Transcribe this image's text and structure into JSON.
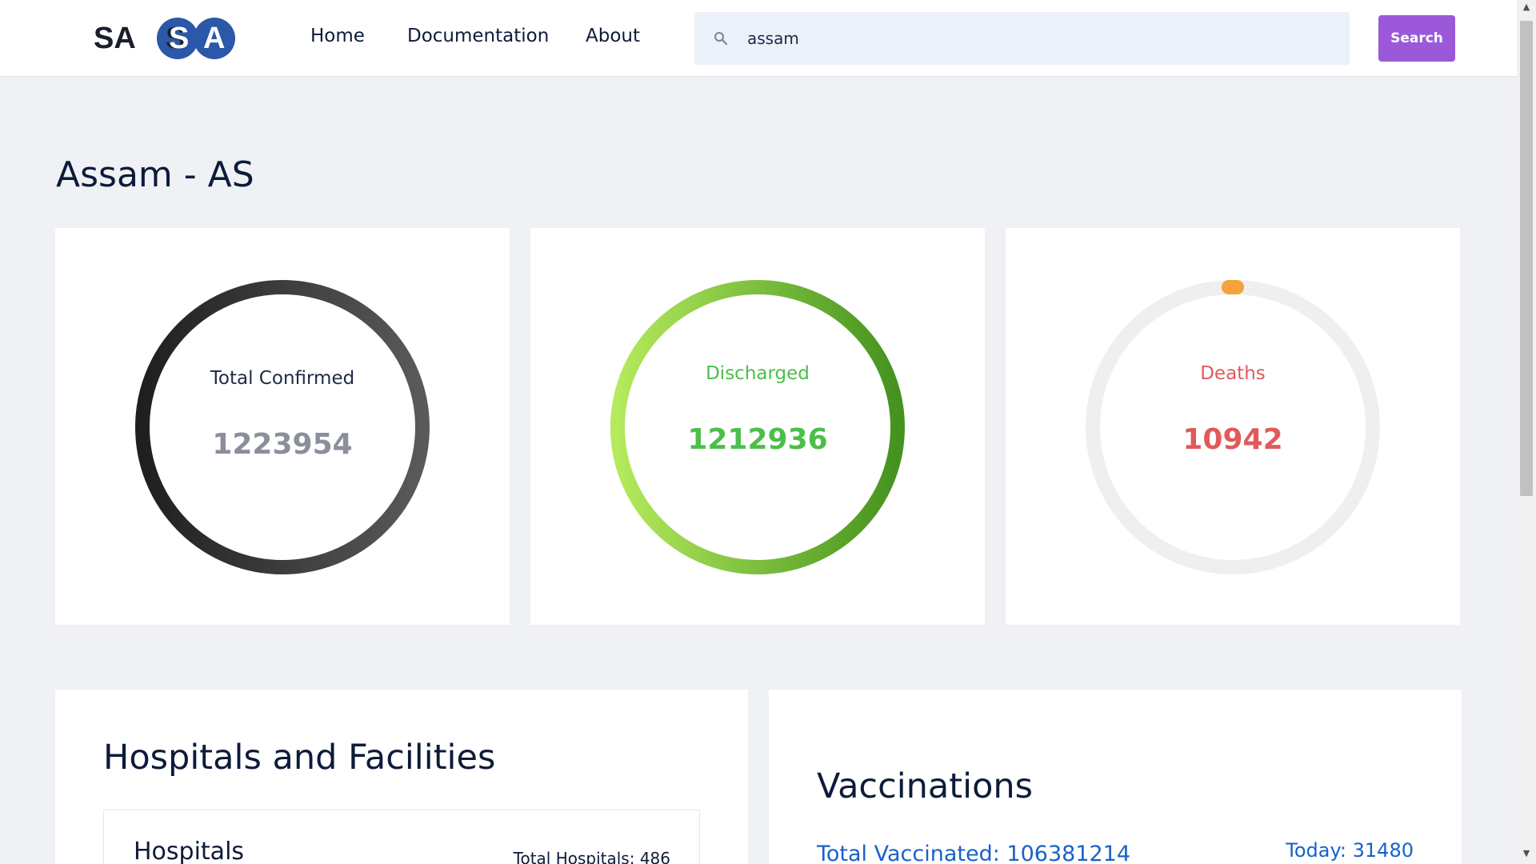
{
  "header": {
    "logo_text": "SASA",
    "nav": {
      "home": "Home",
      "documentation": "Documentation",
      "about": "About"
    },
    "search": {
      "value": "assam",
      "button": "Search"
    }
  },
  "page": {
    "title": "Assam - AS"
  },
  "stats": {
    "confirmed": {
      "label": "Total Confirmed",
      "value": "1223954"
    },
    "discharged": {
      "label": "Discharged",
      "value": "1212936"
    },
    "deaths": {
      "label": "Deaths",
      "value": "10942"
    }
  },
  "hospitals": {
    "heading": "Hospitals and Facilities",
    "sub_heading": "Hospitals",
    "total": "Total Hospitals: 486"
  },
  "vaccinations": {
    "heading": "Vaccinations",
    "total": "Total Vaccinated: 106381214",
    "today": "Today: 31480"
  },
  "colors": {
    "accent": "#9b59d9",
    "confirmed_ring": "#2b2b2b",
    "discharged_ring_start": "#b4ea5c",
    "discharged_ring_end": "#45921f",
    "deaths_marker": "#f5a23a",
    "deaths_text": "#e05a5a",
    "discharged_text": "#4cbf4a",
    "link_blue": "#1762c7"
  }
}
